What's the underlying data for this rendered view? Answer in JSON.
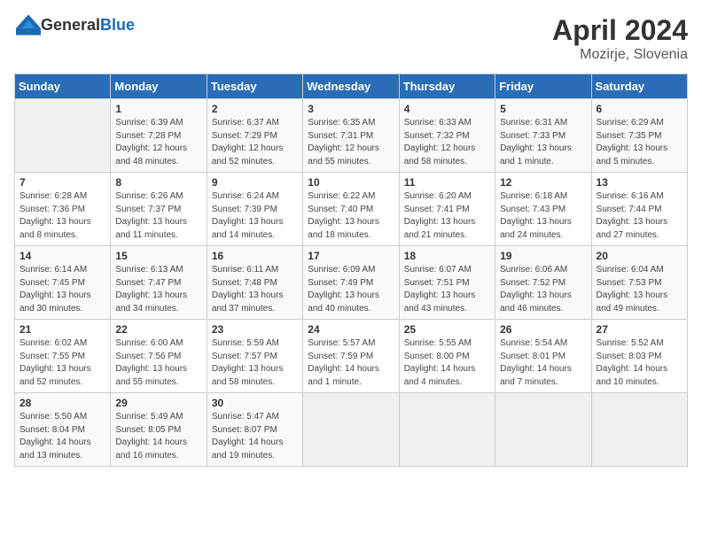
{
  "header": {
    "logo_general": "General",
    "logo_blue": "Blue",
    "month_year": "April 2024",
    "location": "Mozirje, Slovenia"
  },
  "weekdays": [
    "Sunday",
    "Monday",
    "Tuesday",
    "Wednesday",
    "Thursday",
    "Friday",
    "Saturday"
  ],
  "weeks": [
    [
      {
        "day": "",
        "info": ""
      },
      {
        "day": "1",
        "info": "Sunrise: 6:39 AM\nSunset: 7:28 PM\nDaylight: 12 hours\nand 48 minutes."
      },
      {
        "day": "2",
        "info": "Sunrise: 6:37 AM\nSunset: 7:29 PM\nDaylight: 12 hours\nand 52 minutes."
      },
      {
        "day": "3",
        "info": "Sunrise: 6:35 AM\nSunset: 7:31 PM\nDaylight: 12 hours\nand 55 minutes."
      },
      {
        "day": "4",
        "info": "Sunrise: 6:33 AM\nSunset: 7:32 PM\nDaylight: 12 hours\nand 58 minutes."
      },
      {
        "day": "5",
        "info": "Sunrise: 6:31 AM\nSunset: 7:33 PM\nDaylight: 13 hours\nand 1 minute."
      },
      {
        "day": "6",
        "info": "Sunrise: 6:29 AM\nSunset: 7:35 PM\nDaylight: 13 hours\nand 5 minutes."
      }
    ],
    [
      {
        "day": "7",
        "info": "Sunrise: 6:28 AM\nSunset: 7:36 PM\nDaylight: 13 hours\nand 8 minutes."
      },
      {
        "day": "8",
        "info": "Sunrise: 6:26 AM\nSunset: 7:37 PM\nDaylight: 13 hours\nand 11 minutes."
      },
      {
        "day": "9",
        "info": "Sunrise: 6:24 AM\nSunset: 7:39 PM\nDaylight: 13 hours\nand 14 minutes."
      },
      {
        "day": "10",
        "info": "Sunrise: 6:22 AM\nSunset: 7:40 PM\nDaylight: 13 hours\nand 18 minutes."
      },
      {
        "day": "11",
        "info": "Sunrise: 6:20 AM\nSunset: 7:41 PM\nDaylight: 13 hours\nand 21 minutes."
      },
      {
        "day": "12",
        "info": "Sunrise: 6:18 AM\nSunset: 7:43 PM\nDaylight: 13 hours\nand 24 minutes."
      },
      {
        "day": "13",
        "info": "Sunrise: 6:16 AM\nSunset: 7:44 PM\nDaylight: 13 hours\nand 27 minutes."
      }
    ],
    [
      {
        "day": "14",
        "info": "Sunrise: 6:14 AM\nSunset: 7:45 PM\nDaylight: 13 hours\nand 30 minutes."
      },
      {
        "day": "15",
        "info": "Sunrise: 6:13 AM\nSunset: 7:47 PM\nDaylight: 13 hours\nand 34 minutes."
      },
      {
        "day": "16",
        "info": "Sunrise: 6:11 AM\nSunset: 7:48 PM\nDaylight: 13 hours\nand 37 minutes."
      },
      {
        "day": "17",
        "info": "Sunrise: 6:09 AM\nSunset: 7:49 PM\nDaylight: 13 hours\nand 40 minutes."
      },
      {
        "day": "18",
        "info": "Sunrise: 6:07 AM\nSunset: 7:51 PM\nDaylight: 13 hours\nand 43 minutes."
      },
      {
        "day": "19",
        "info": "Sunrise: 6:06 AM\nSunset: 7:52 PM\nDaylight: 13 hours\nand 46 minutes."
      },
      {
        "day": "20",
        "info": "Sunrise: 6:04 AM\nSunset: 7:53 PM\nDaylight: 13 hours\nand 49 minutes."
      }
    ],
    [
      {
        "day": "21",
        "info": "Sunrise: 6:02 AM\nSunset: 7:55 PM\nDaylight: 13 hours\nand 52 minutes."
      },
      {
        "day": "22",
        "info": "Sunrise: 6:00 AM\nSunset: 7:56 PM\nDaylight: 13 hours\nand 55 minutes."
      },
      {
        "day": "23",
        "info": "Sunrise: 5:59 AM\nSunset: 7:57 PM\nDaylight: 13 hours\nand 58 minutes."
      },
      {
        "day": "24",
        "info": "Sunrise: 5:57 AM\nSunset: 7:59 PM\nDaylight: 14 hours\nand 1 minute."
      },
      {
        "day": "25",
        "info": "Sunrise: 5:55 AM\nSunset: 8:00 PM\nDaylight: 14 hours\nand 4 minutes."
      },
      {
        "day": "26",
        "info": "Sunrise: 5:54 AM\nSunset: 8:01 PM\nDaylight: 14 hours\nand 7 minutes."
      },
      {
        "day": "27",
        "info": "Sunrise: 5:52 AM\nSunset: 8:03 PM\nDaylight: 14 hours\nand 10 minutes."
      }
    ],
    [
      {
        "day": "28",
        "info": "Sunrise: 5:50 AM\nSunset: 8:04 PM\nDaylight: 14 hours\nand 13 minutes."
      },
      {
        "day": "29",
        "info": "Sunrise: 5:49 AM\nSunset: 8:05 PM\nDaylight: 14 hours\nand 16 minutes."
      },
      {
        "day": "30",
        "info": "Sunrise: 5:47 AM\nSunset: 8:07 PM\nDaylight: 14 hours\nand 19 minutes."
      },
      {
        "day": "",
        "info": ""
      },
      {
        "day": "",
        "info": ""
      },
      {
        "day": "",
        "info": ""
      },
      {
        "day": "",
        "info": ""
      }
    ]
  ]
}
